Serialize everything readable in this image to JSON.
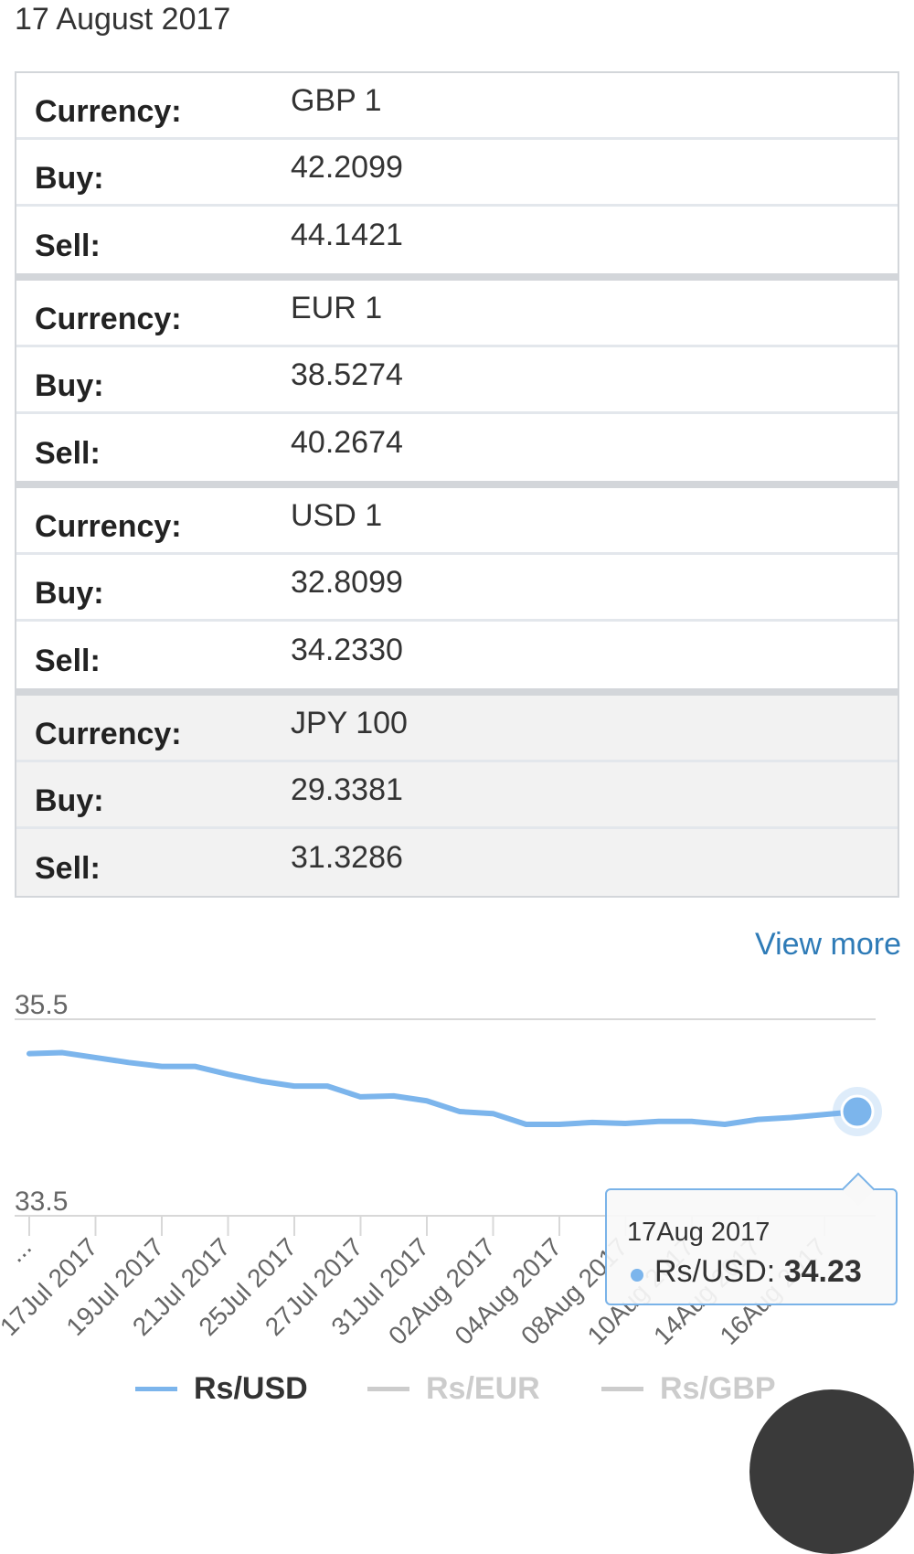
{
  "header": {
    "date": "17 August 2017"
  },
  "rates": [
    {
      "currency_label": "Currency:",
      "currency": "GBP 1",
      "buy_label": "Buy:",
      "buy": "42.2099",
      "sell_label": "Sell:",
      "sell": "44.1421"
    },
    {
      "currency_label": "Currency:",
      "currency": "EUR 1",
      "buy_label": "Buy:",
      "buy": "38.5274",
      "sell_label": "Sell:",
      "sell": "40.2674"
    },
    {
      "currency_label": "Currency:",
      "currency": "USD 1",
      "buy_label": "Buy:",
      "buy": "32.8099",
      "sell_label": "Sell:",
      "sell": "34.2330"
    },
    {
      "currency_label": "Currency:",
      "currency": "JPY 100",
      "buy_label": "Buy:",
      "buy": "29.3381",
      "sell_label": "Sell:",
      "sell": "31.3286"
    }
  ],
  "view_more": "View more",
  "chart_data": {
    "type": "line",
    "ylim": [
      33.5,
      35.5
    ],
    "y_ticks": [
      "35.5",
      "33.5"
    ],
    "grid": true,
    "x_tick_labels": [
      "...",
      "17Jul 2017",
      "19Jul 2017",
      "21Jul 2017",
      "25Jul 2017",
      "27Jul 2017",
      "31Jul 2017",
      "02Aug 2017",
      "04Aug 2017",
      "08Aug 2017",
      "10Aug 2017",
      "14Aug 2017",
      "16Aug 2017"
    ],
    "series": [
      {
        "name": "Rs/USD",
        "color": "#7cb5ec",
        "visible": true,
        "values": [
          35.15,
          35.16,
          35.11,
          35.06,
          35.02,
          35.02,
          34.94,
          34.87,
          34.82,
          34.82,
          34.71,
          34.72,
          34.67,
          34.56,
          34.54,
          34.43,
          34.43,
          34.45,
          34.44,
          34.46,
          34.46,
          34.43,
          34.48,
          34.5,
          34.53,
          34.56
        ]
      },
      {
        "name": "Rs/EUR",
        "color": "#cccccc",
        "visible": false,
        "values": []
      },
      {
        "name": "Rs/GBP",
        "color": "#cccccc",
        "visible": false,
        "values": []
      }
    ],
    "tooltip": {
      "date": "17Aug 2017",
      "series": "Rs/USD",
      "value": "34.23"
    },
    "legend_position": "bottom"
  }
}
